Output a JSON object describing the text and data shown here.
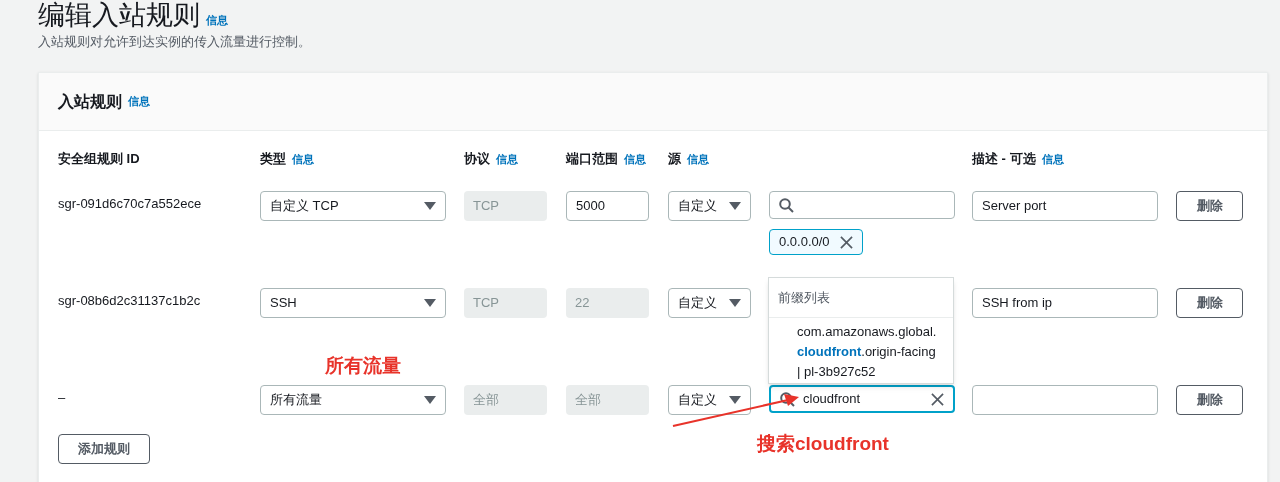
{
  "page": {
    "title": "编辑入站规则",
    "info": "信息",
    "description": "入站规则对允许到达实例的传入流量进行控制。"
  },
  "panel": {
    "title": "入站规则",
    "info": "信息",
    "columns": [
      {
        "label": "安全组规则 ID"
      },
      {
        "label": "类型",
        "info": "信息"
      },
      {
        "label": "协议",
        "info": "信息"
      },
      {
        "label": "端口范围",
        "info": "信息"
      },
      {
        "label": "源",
        "info": "信息"
      },
      {
        "label": "描述 - 可选",
        "info": "信息"
      }
    ],
    "rules": [
      {
        "id": "sgr-091d6c70c7a552ece",
        "type": "自定义 TCP",
        "protocol": "TCP",
        "port": "5000",
        "port_disabled": false,
        "source_type": "自定义",
        "source_search": {
          "focused": false
        },
        "chips": [
          "0.0.0.0/0"
        ],
        "description": "Server port",
        "delete": "删除"
      },
      {
        "id": "sgr-08b6d2c31137c1b2c",
        "type": "SSH",
        "protocol": "TCP",
        "port": "22",
        "port_disabled": true,
        "source_type": "自定义",
        "description": "SSH from ip",
        "delete": "删除"
      },
      {
        "id": "–",
        "type": "所有流量",
        "protocol": "全部",
        "port": "全部",
        "port_disabled": true,
        "source_type": "自定义",
        "source_search": {
          "value": "cloudfront",
          "focused": true
        },
        "delete": "删除"
      }
    ],
    "add_rule": "添加规则",
    "dropdown": {
      "group_label": "前缀列表",
      "option_lines": [
        "com.amazonaws.global.",
        "**cloudfront**.origin-facing",
        "| pl-3b927c52"
      ]
    }
  },
  "annotations": [
    {
      "text": "所有流量"
    },
    {
      "text": "搜索cloudfront"
    }
  ]
}
